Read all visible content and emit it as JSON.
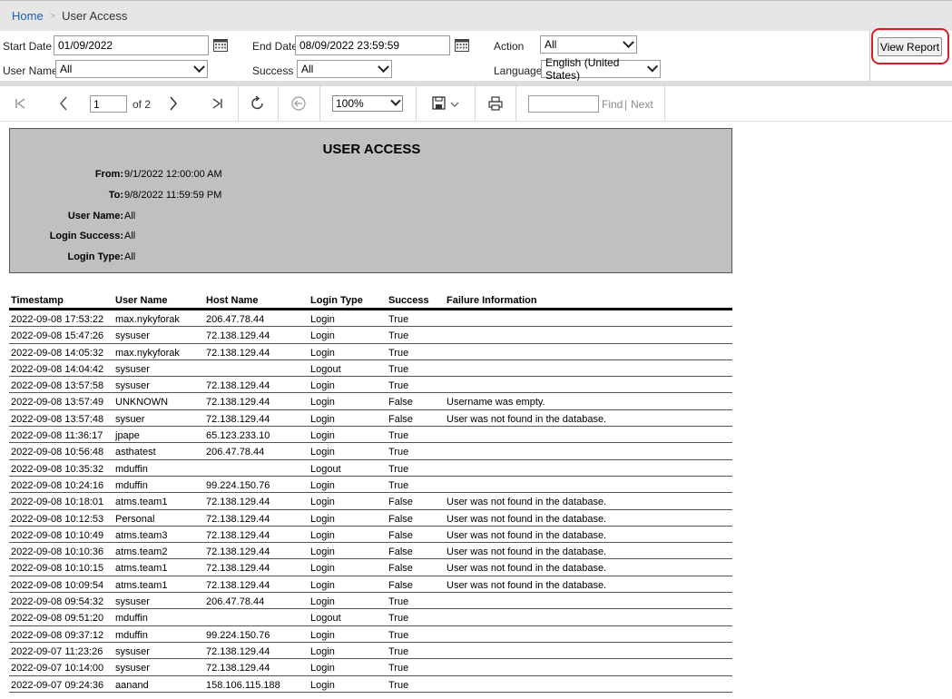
{
  "breadcrumb": {
    "home": "Home",
    "current": "User Access"
  },
  "params": {
    "start_date_label": "Start Date",
    "start_date_value": "01/09/2022",
    "end_date_label": "End Date",
    "end_date_value": "08/09/2022 23:59:59",
    "action_label": "Action",
    "action_value": "All",
    "user_name_label": "User Name",
    "user_name_value": "All",
    "success_label": "Success",
    "success_value": "All",
    "language_label": "Language",
    "language_value": "English (United States)",
    "view_report_label": "View Report"
  },
  "toolbar": {
    "page_value": "1",
    "of_pages": "of 2",
    "zoom_value": "100%",
    "find_label": "Find",
    "find_separator": "|",
    "next_label": "Next"
  },
  "report": {
    "title": "USER ACCESS",
    "header_fields": [
      {
        "label": "From:",
        "value": "9/1/2022 12:00:00 AM"
      },
      {
        "label": "To:",
        "value": "9/8/2022 11:59:59 PM"
      },
      {
        "label": "User Name:",
        "value": "All"
      },
      {
        "label": "Login Success:",
        "value": "All"
      },
      {
        "label": "Login Type:",
        "value": "All"
      }
    ],
    "columns": [
      "Timestamp",
      "User Name",
      "Host Name",
      "Login Type",
      "Success",
      "Failure Information"
    ],
    "rows": [
      [
        "2022-09-08 17:53:22",
        "max.nykyforak",
        "206.47.78.44",
        "Login",
        "True",
        ""
      ],
      [
        "2022-09-08 15:47:26",
        "sysuser",
        "72.138.129.44",
        "Login",
        "True",
        ""
      ],
      [
        "2022-09-08 14:05:32",
        "max.nykyforak",
        "72.138.129.44",
        "Login",
        "True",
        ""
      ],
      [
        "2022-09-08 14:04:42",
        "sysuser",
        "",
        "Logout",
        "True",
        ""
      ],
      [
        "2022-09-08 13:57:58",
        "sysuser",
        "72.138.129.44",
        "Login",
        "True",
        ""
      ],
      [
        "2022-09-08 13:57:49",
        "UNKNOWN",
        "72.138.129.44",
        "Login",
        "False",
        "Username was empty."
      ],
      [
        "2022-09-08 13:57:48",
        "sysuer",
        "72.138.129.44",
        "Login",
        "False",
        "User was not found in the database."
      ],
      [
        "2022-09-08 11:36:17",
        "jpape",
        "65.123.233.10",
        "Login",
        "True",
        ""
      ],
      [
        "2022-09-08 10:56:48",
        "asthatest",
        "206.47.78.44",
        "Login",
        "True",
        ""
      ],
      [
        "2022-09-08 10:35:32",
        "mduffin",
        "",
        "Logout",
        "True",
        ""
      ],
      [
        "2022-09-08 10:24:16",
        "mduffin",
        "99.224.150.76",
        "Login",
        "True",
        ""
      ],
      [
        "2022-09-08 10:18:01",
        "atms.team1",
        "72.138.129.44",
        "Login",
        "False",
        "User was not found in the database."
      ],
      [
        "2022-09-08 10:12:53",
        "Personal",
        "72.138.129.44",
        "Login",
        "False",
        "User was not found in the database."
      ],
      [
        "2022-09-08 10:10:49",
        "atms.team3",
        "72.138.129.44",
        "Login",
        "False",
        "User was not found in the database."
      ],
      [
        "2022-09-08 10:10:36",
        "atms.team2",
        "72.138.129.44",
        "Login",
        "False",
        "User was not found in the database."
      ],
      [
        "2022-09-08 10:10:15",
        "atms.team1",
        "72.138.129.44",
        "Login",
        "False",
        "User was not found in the database."
      ],
      [
        "2022-09-08 10:09:54",
        "atms.team1",
        "72.138.129.44",
        "Login",
        "False",
        "User was not found in the database."
      ],
      [
        "2022-09-08 09:54:32",
        "sysuser",
        "206.47.78.44",
        "Login",
        "True",
        ""
      ],
      [
        "2022-09-08 09:51:20",
        "mduffin",
        "",
        "Logout",
        "True",
        ""
      ],
      [
        "2022-09-08 09:37:12",
        "mduffin",
        "99.224.150.76",
        "Login",
        "True",
        ""
      ],
      [
        "2022-09-07 11:23:26",
        "sysuser",
        "72.138.129.44",
        "Login",
        "True",
        ""
      ],
      [
        "2022-09-07 10:14:00",
        "sysuser",
        "72.138.129.44",
        "Login",
        "True",
        ""
      ],
      [
        "2022-09-07 09:24:36",
        "aanand",
        "158.106.115.188",
        "Login",
        "True",
        ""
      ]
    ]
  }
}
